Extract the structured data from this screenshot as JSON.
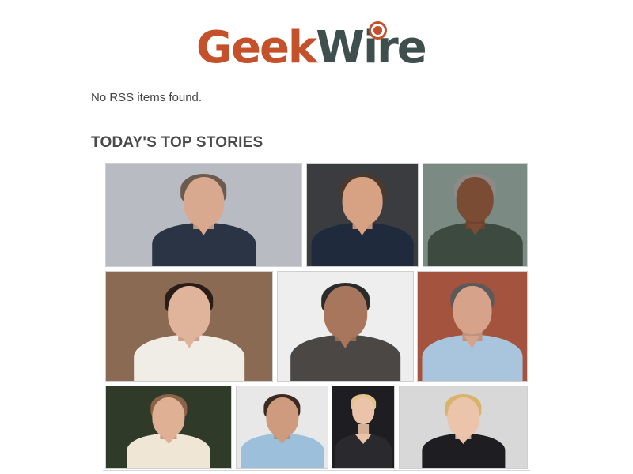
{
  "logo": {
    "part1": "Geek",
    "part2": "Wire"
  },
  "rss": {
    "message": "No RSS items found."
  },
  "section": {
    "title": "TODAY'S TOP STORIES"
  },
  "tiles": [
    {
      "name": "story-photo-1",
      "bg": "#b8bcc2",
      "suit": "#2b3445",
      "skin": "#d9a98f",
      "hair": "#6b5a4e"
    },
    {
      "name": "story-photo-2",
      "bg": "#3b3c3f",
      "suit": "#1f2a3c",
      "skin": "#d7a284",
      "hair": "#4a3a2e"
    },
    {
      "name": "story-photo-3",
      "bg": "#7c8a84",
      "suit": "#3d4a3f",
      "skin": "#7a4c34",
      "hair": "#8e8a86"
    },
    {
      "name": "story-photo-4",
      "bg": "#8a6a52",
      "suit": "#f0ece6",
      "skin": "#e0b49a",
      "hair": "#2a1d18"
    },
    {
      "name": "story-photo-5",
      "bg": "#eeeeee",
      "suit": "#4a4744",
      "skin": "#a8765c",
      "hair": "#2b2b2b"
    },
    {
      "name": "story-photo-6",
      "bg": "#a4533f",
      "suit": "#a9c4dd",
      "skin": "#d6a28a",
      "hair": "#5a5a5a"
    },
    {
      "name": "story-photo-7",
      "bg": "#2f3a28",
      "suit": "#efe6d6",
      "skin": "#e0b095",
      "hair": "#8a6448"
    },
    {
      "name": "story-photo-8",
      "bg": "#e8e8e8",
      "suit": "#9cc0dc",
      "skin": "#cf9b7e",
      "hair": "#3a2a22"
    },
    {
      "name": "story-photo-9",
      "bg": "#1e1e22",
      "suit": "#2a2a2e",
      "skin": "#ebc3a8",
      "hair": "#e2c48a"
    },
    {
      "name": "story-photo-10",
      "bg": "#d8d8d8",
      "suit": "#1d1d22",
      "skin": "#ecc4ab",
      "hair": "#d8b46a"
    }
  ]
}
